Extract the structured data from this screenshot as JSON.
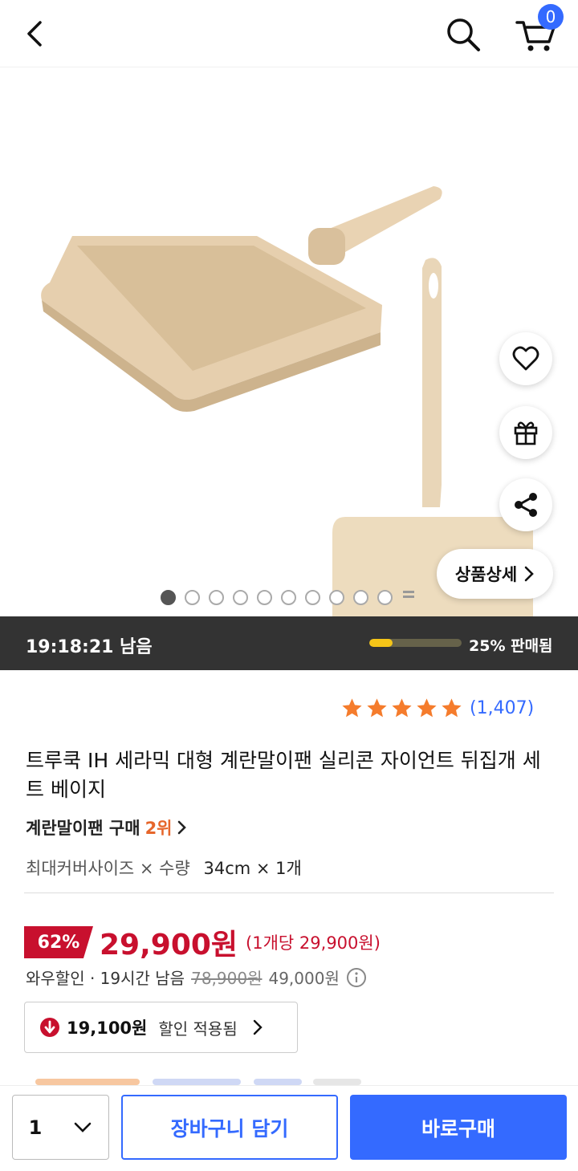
{
  "header": {
    "back_icon": "back-arrow-icon",
    "search_icon": "search-icon",
    "cart_icon": "cart-icon",
    "cart_count": "0",
    "accent": "#346aff"
  },
  "gallery": {
    "detail_label": "상품상세",
    "image_count": 10,
    "active_index": 0,
    "actions": [
      "heart-icon",
      "gift-icon",
      "share-icon"
    ]
  },
  "timer": {
    "remaining": "19:18:21 남음",
    "sold_label": "25% 판매됨",
    "sold_fraction": 0.25
  },
  "rating": {
    "stars": 5,
    "count": "(1,407)",
    "star_color": "#f57c2c"
  },
  "product": {
    "title": "트루쿡 IH 세라믹 대형 계란말이팬 실리콘 자이언트 뒤집개 세트 베이지",
    "rank_label": "계란말이팬 구매",
    "rank_value": "2위",
    "option_label": "최대커버사이즈 × 수량",
    "option_value": "34cm × 1개"
  },
  "price": {
    "discount": "62%",
    "sale_price": "29,900원",
    "unit_price": "(1개당 29,900원)",
    "wow_label": "와우할인 · 19시간 남음",
    "original_price": "78,900원",
    "base_price": "49,000원",
    "sale_color": "#c8102e"
  },
  "coupon": {
    "amount": "19,100원",
    "text": "할인 적용됨"
  },
  "bottom": {
    "quantity": "1",
    "cart_label": "장바구니 담기",
    "buy_label": "바로구매"
  }
}
